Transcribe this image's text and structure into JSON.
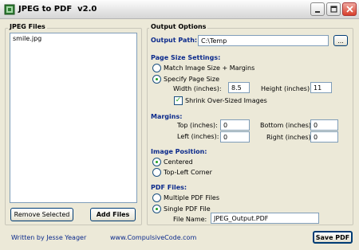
{
  "window": {
    "title": "JPEG to PDF  v2.0"
  },
  "jpeg_files": {
    "group_label": "JPEG Files",
    "items": [
      "smile.jpg"
    ],
    "remove_label": "Remove Selected",
    "add_label": "Add Files"
  },
  "output": {
    "group_label": "Output Options",
    "path_label": "Output Path:",
    "path_value": "C:\\Temp",
    "browse_label": "..."
  },
  "page_size": {
    "heading": "Page Size Settings:",
    "opt_match": "Match Image Size + Margins",
    "opt_specify": "Specify Page Size",
    "width_label": "Width (inches):",
    "width_value": "8.5",
    "height_label": "Height (inches):",
    "height_value": "11",
    "shrink_label": "Shrink Over-Sized Images",
    "selected": "Specify Page Size",
    "shrink_checked": true
  },
  "margins": {
    "heading": "Margins:",
    "top_label": "Top (inches):",
    "top_value": "0",
    "bottom_label": "Bottom (inches):",
    "bottom_value": "0",
    "left_label": "Left (inches):",
    "left_value": "0",
    "right_label": "Right (inches):",
    "right_value": "0"
  },
  "image_position": {
    "heading": "Image Position:",
    "opt_centered": "Centered",
    "opt_topleft": "Top-Left Corner",
    "selected": "Centered"
  },
  "pdf_files": {
    "heading": "PDF Files:",
    "opt_multiple": "Multiple PDF Files",
    "opt_single": "Single PDF File",
    "filename_label": "File Name:",
    "filename_value": "JPEG_Output.PDF",
    "selected": "Single PDF File"
  },
  "footer": {
    "author": "Written by Jesse Yeager",
    "website": "www.CompulsiveCode.com",
    "save_label": "Save PDF"
  },
  "colors": {
    "accent_text": "#0b2a8c",
    "background": "#ece9d8"
  }
}
